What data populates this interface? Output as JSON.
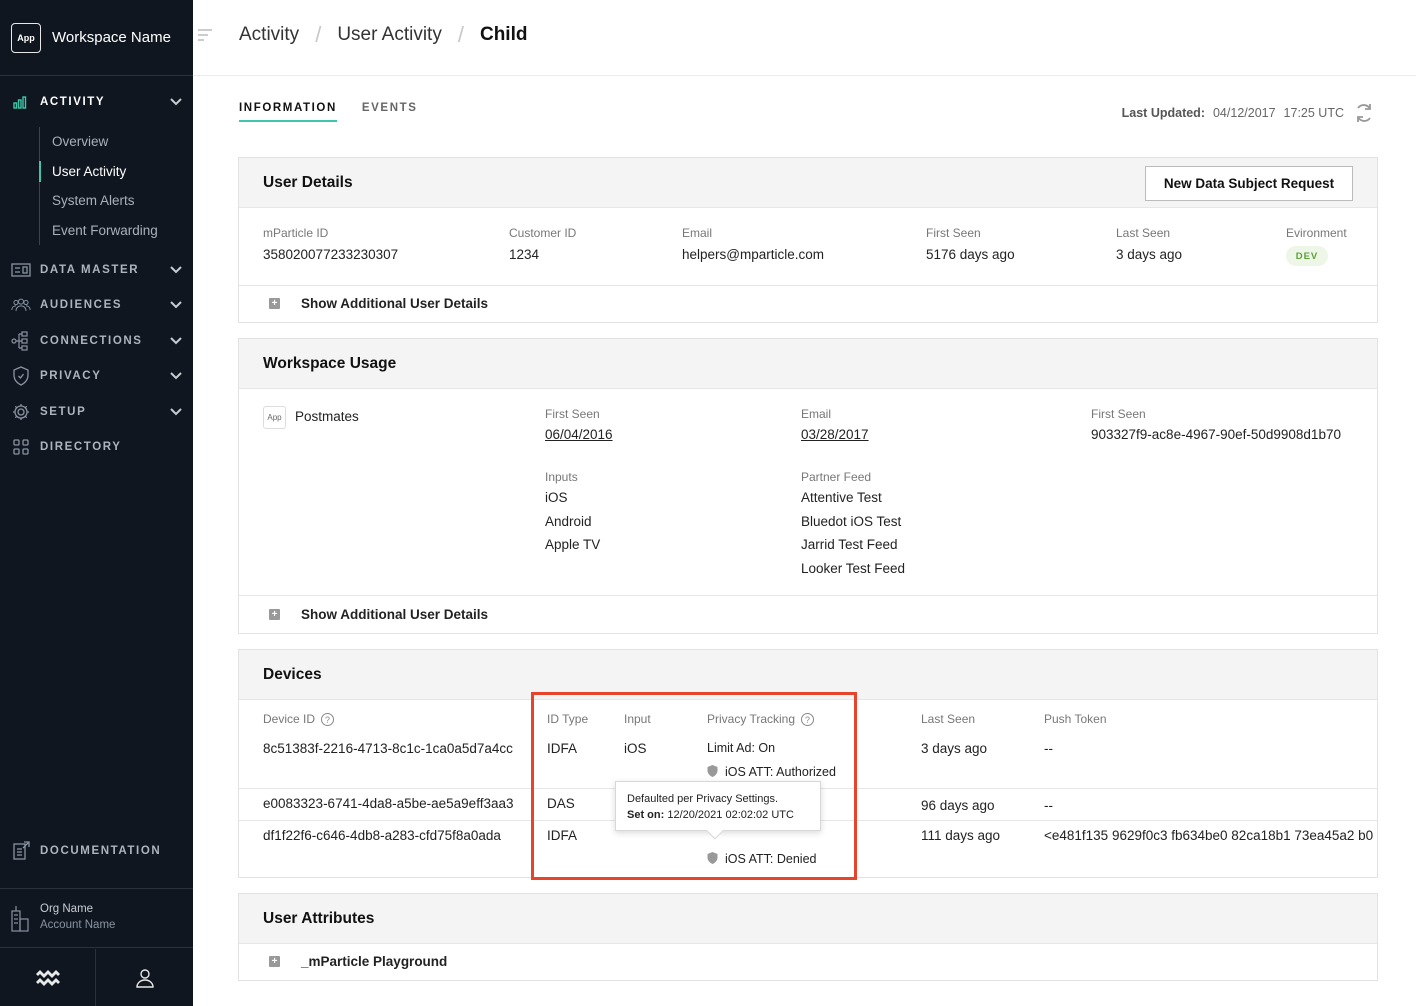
{
  "workspace": {
    "app_badge": "App",
    "name": "Workspace Name"
  },
  "sidebar": {
    "sections": [
      {
        "label": "ACTIVITY"
      },
      {
        "label": "DATA MASTER"
      },
      {
        "label": "AUDIENCES"
      },
      {
        "label": "CONNECTIONS"
      },
      {
        "label": "PRIVACY"
      },
      {
        "label": "SETUP"
      },
      {
        "label": "DIRECTORY"
      }
    ],
    "activity_items": [
      "Overview",
      "User Activity",
      "System Alerts",
      "Event Forwarding"
    ],
    "documentation": "DOCUMENTATION",
    "org_name": "Org Name",
    "account_name": "Account Name"
  },
  "breadcrumb": {
    "c1": "Activity",
    "c2": "User Activity",
    "c3": "Child"
  },
  "tabs": {
    "information": "INFORMATION",
    "events": "EVENTS"
  },
  "last_updated": {
    "label": "Last Updated:",
    "date": "04/12/2017",
    "time": "17:25 UTC"
  },
  "user_details": {
    "title": "User Details",
    "button": "New Data Subject Request",
    "fields": {
      "mparticle_id": {
        "label": "mParticle ID",
        "value": "358020077233230307"
      },
      "customer_id": {
        "label": "Customer ID",
        "value": "1234"
      },
      "email": {
        "label": "Email",
        "value": "helpers@mparticle.com"
      },
      "first_seen": {
        "label": "First Seen",
        "value": "5176 days ago"
      },
      "last_seen": {
        "label": "Last Seen",
        "value": "3 days ago"
      },
      "environment": {
        "label": "Evironment",
        "value": "DEV"
      }
    },
    "expander": "Show Additional User Details"
  },
  "workspace_usage": {
    "title": "Workspace Usage",
    "app_badge": "App",
    "app_name": "Postmates",
    "first_seen": {
      "label": "First Seen",
      "value": "06/04/2016"
    },
    "email": {
      "label": "Email",
      "value": "03/28/2017"
    },
    "first_seen_2": {
      "label": "First Seen",
      "value": "903327f9-ac8e-4967-90ef-50d9908d1b70"
    },
    "inputs": {
      "label": "Inputs",
      "values": [
        "iOS",
        "Android",
        "Apple TV"
      ]
    },
    "partner_feed": {
      "label": "Partner Feed",
      "values": [
        "Attentive Test",
        "Bluedot iOS Test",
        "Jarrid Test Feed",
        "Looker Test Feed"
      ]
    },
    "expander": "Show Additional User Details"
  },
  "devices": {
    "title": "Devices",
    "headers": {
      "device_id": "Device ID",
      "id_type": "ID Type",
      "input": "Input",
      "privacy": "Privacy Tracking",
      "last_seen": "Last Seen",
      "push_token": "Push Token"
    },
    "rows": [
      {
        "device_id": "8c51383f-2216-4713-8c1c-1ca0a5d7a4cc",
        "id_type": "IDFA",
        "input": "iOS",
        "privacy_1": "Limit Ad: On",
        "privacy_2": "iOS ATT: Authorized",
        "last_seen": "3 days ago",
        "push_token": "--"
      },
      {
        "device_id": "e0083323-6741-4da8-a5be-ae5a9eff3aa3",
        "id_type": "DAS",
        "input": "",
        "privacy_1": "",
        "privacy_2": "",
        "last_seen": "96 days ago",
        "push_token": "--"
      },
      {
        "device_id": "df1f22f6-c646-4db8-a283-cfd75f8a0ada",
        "id_type": "IDFA",
        "input": "",
        "privacy_1": "",
        "privacy_2": "iOS ATT: Denied",
        "last_seen": "111 days ago",
        "push_token": "<e481f135 9629f0c3 fb634be0 82ca18b1 73ea45a2 b0"
      }
    ],
    "tooltip": {
      "line1": "Defaulted per Privacy Settings.",
      "label": "Set on:",
      "value": "12/20/2021 02:02:02 UTC"
    }
  },
  "user_attributes": {
    "title": "User Attributes",
    "expander": "_mParticle Playground"
  },
  "colors": {
    "accent": "#3fc6a8",
    "highlight": "#e6452b",
    "sidebar": "#0f1620"
  }
}
